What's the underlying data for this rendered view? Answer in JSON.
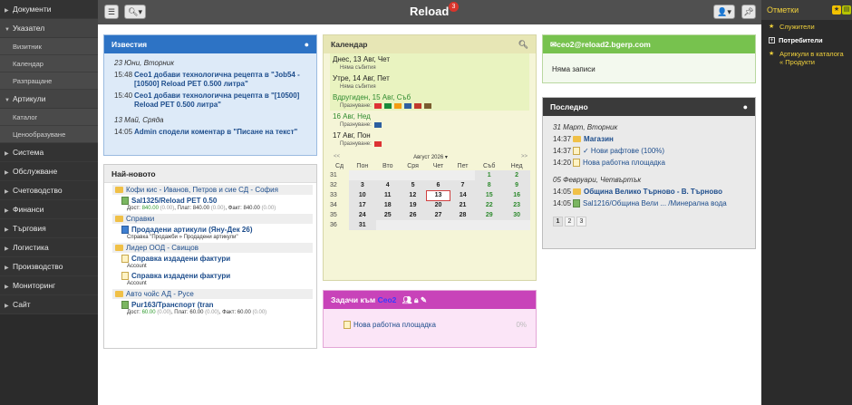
{
  "sidebar": {
    "items": [
      {
        "label": "Документи",
        "open": false
      },
      {
        "label": "Указател",
        "open": true,
        "subs": [
          "Визитник",
          "Календар",
          "Разпращане"
        ]
      },
      {
        "label": "Артикули",
        "open": true,
        "subs": [
          "Каталог",
          "Ценообразуване"
        ]
      },
      {
        "label": "Система",
        "open": false
      },
      {
        "label": "Обслужване",
        "open": false
      },
      {
        "label": "Счетоводство",
        "open": false
      },
      {
        "label": "Финанси",
        "open": false
      },
      {
        "label": "Търговия",
        "open": false
      },
      {
        "label": "Логистика",
        "open": false
      },
      {
        "label": "Производство",
        "open": false
      },
      {
        "label": "Мониторинг",
        "open": false
      },
      {
        "label": "Сайт",
        "open": false
      }
    ]
  },
  "topbar": {
    "brand": "Reload",
    "notifications": "3"
  },
  "right_sidebar": {
    "title": "Отметки",
    "items": [
      {
        "label": "Служители",
        "style": "star"
      },
      {
        "label": "Потребители",
        "style": "box"
      },
      {
        "label": "Артикули в каталога « Продукти",
        "style": "star"
      }
    ]
  },
  "news": {
    "title": "Известия",
    "groups": [
      {
        "date": "23 Юни, Вторник",
        "rows": [
          {
            "time": "15:48",
            "text": "Ceo1 добави технологична рецепта в \"Job54 - [10500] Reload PET 0.500 литра\""
          },
          {
            "time": "15:40",
            "text": "Ceo1 добави технологична рецепта в \"[10500] Reload PET 0.500 литра\""
          }
        ]
      },
      {
        "date": "13 Май, Сряда",
        "rows": [
          {
            "time": "14:05",
            "text": "Admin сподели коментар в \"Писане на текст\""
          }
        ]
      }
    ]
  },
  "newest": {
    "title": "Най-новото",
    "companies": [
      {
        "name": "Кофи кис - Иванов, Петров и сие СД - София",
        "docs": [
          {
            "label": "Sal1325/Reload PET 0.50",
            "icon": "green",
            "meta": {
              "d_label": "Дост:",
              "d_val": "840.00",
              "d_extra": "(0.00)",
              "p_label": "Плат:",
              "p_val": "840.00",
              "p_extra": "(0.00)",
              "f_label": "Факт:",
              "f_val": "840.00",
              "f_extra": "(0.00)"
            }
          }
        ]
      },
      {
        "name": "Справки",
        "docs": [
          {
            "label": "Продадени артикули (Яну-Дек 26)",
            "icon": "blue",
            "meta_text": "Справка \"Продажби » Продадени артикули\""
          }
        ]
      },
      {
        "name": "Лидер ООД - Свищов",
        "docs": [
          {
            "label": "Справка издадени фактури",
            "icon": "note",
            "meta_text": "Account"
          },
          {
            "label": "Справка издадени фактури",
            "icon": "note",
            "meta_text": "Account"
          }
        ]
      },
      {
        "name": "Авто чойс АД - Русе",
        "docs": [
          {
            "label": "Pur163/Транспорт (tran",
            "icon": "green",
            "meta": {
              "d_label": "Дост:",
              "d_val": "60.00",
              "d_extra": "(0.00)",
              "p_label": "Плат:",
              "p_val": "60.00",
              "p_extra": "(0.00)",
              "f_label": "Факт:",
              "f_val": "60.00",
              "f_extra": "(0.00)"
            }
          }
        ]
      }
    ]
  },
  "calendar": {
    "title": "Календар",
    "days": [
      {
        "label": "Днес, 13 Авг, Чет",
        "event": "Няма събития",
        "highlight": true,
        "green": false,
        "flags": []
      },
      {
        "label": "Утре, 14 Авг, Пет",
        "event": "Няма събития",
        "highlight": true,
        "green": false,
        "flags": []
      },
      {
        "label": "Вдругиден, 15 Авг, Съб",
        "event": "Празнуване:",
        "highlight": true,
        "green": true,
        "flags": [
          "#d33",
          "#1a8a3a",
          "#f39c12",
          "#2d5fa0",
          "#c0392b",
          "#7a5c2e"
        ]
      },
      {
        "label": "16 Авг, Нед",
        "event": "Празнуване:",
        "highlight": false,
        "green": true,
        "flags": [
          "#2d5fa0"
        ]
      },
      {
        "label": "17 Авг, Пон",
        "event": "Празнуване:",
        "highlight": false,
        "green": false,
        "flags": [
          "#d33"
        ]
      }
    ],
    "nav_prev": "<<",
    "nav_next": ">>",
    "month": "Август 2026",
    "weekdays": [
      "Сд",
      "Пон",
      "Вто",
      "Сря",
      "Чет",
      "Пет",
      "Съб",
      "Нед"
    ],
    "weeks": [
      {
        "wk": "31",
        "days": [
          "",
          "",
          "",
          "",
          "",
          "1",
          "2"
        ]
      },
      {
        "wk": "32",
        "days": [
          "3",
          "4",
          "5",
          "6",
          "7",
          "8",
          "9"
        ]
      },
      {
        "wk": "33",
        "days": [
          "10",
          "11",
          "12",
          "13",
          "14",
          "15",
          "16"
        ]
      },
      {
        "wk": "34",
        "days": [
          "17",
          "18",
          "19",
          "20",
          "21",
          "22",
          "23"
        ]
      },
      {
        "wk": "35",
        "days": [
          "24",
          "25",
          "26",
          "27",
          "28",
          "29",
          "30"
        ]
      },
      {
        "wk": "36",
        "days": [
          "31",
          "",
          "",
          "",
          "",
          "",
          ""
        ]
      }
    ],
    "today": "13"
  },
  "tasks": {
    "title": "Задачи към",
    "user": "Ceo2",
    "rows": [
      {
        "label": "Нова работна площадка",
        "pct": "0%"
      }
    ]
  },
  "mail": {
    "title": "ceo2@reload2.bgerp.com",
    "empty": "Няма записи"
  },
  "recent": {
    "title": "Последно",
    "groups": [
      {
        "date": "31 Март, Вторник",
        "rows": [
          {
            "time": "14:37",
            "text": "Магазин",
            "icon": "folder",
            "bold": true
          },
          {
            "time": "14:37",
            "text": "✓ Нови рафтове (100%)",
            "icon": "note",
            "bold": false
          },
          {
            "time": "14:20",
            "text": "Нова работна площадка",
            "icon": "note",
            "bold": false
          }
        ]
      },
      {
        "date": "05 Февруари, Четвъртък",
        "rows": [
          {
            "time": "14:05",
            "text": "Община Велико Търново - В. Търново",
            "icon": "folder",
            "bold": true
          },
          {
            "time": "14:05",
            "text": "Sal1216/Община Вели ... /Минерална вода",
            "icon": "green",
            "bold": false
          }
        ]
      }
    ],
    "pages": [
      "1",
      "2",
      "3"
    ]
  },
  "colors": {
    "news_header": "#2d73c5",
    "calendar_bg": "#f5f5d7",
    "tasks_header": "#c843b9",
    "mail_header": "#77c24e",
    "recent_header": "#3a3a3a",
    "bookmark_accent": "#f2d23c"
  }
}
